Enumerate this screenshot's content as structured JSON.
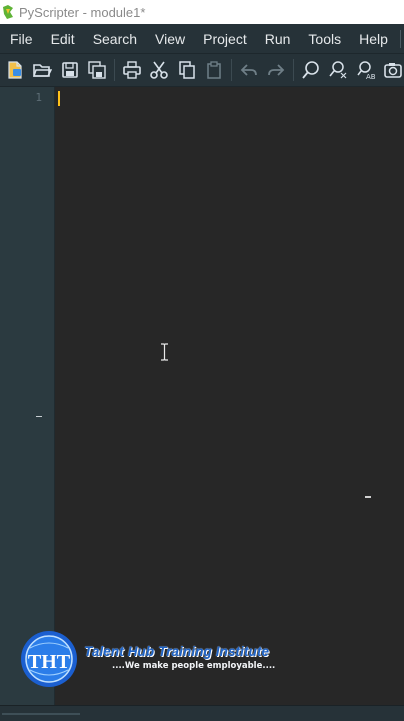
{
  "window": {
    "title": "PyScripter - module1*"
  },
  "menu": {
    "items": [
      "File",
      "Edit",
      "Search",
      "View",
      "Project",
      "Run",
      "Tools",
      "Help"
    ]
  },
  "toolbar": {
    "icons": [
      "new-file-icon",
      "open-folder-icon",
      "save-icon",
      "save-all-icon",
      "print-icon",
      "cut-icon",
      "copy-icon",
      "paste-icon",
      "undo-icon",
      "redo-icon",
      "find-icon",
      "find-in-files-icon",
      "replace-icon",
      "screenshot-icon"
    ]
  },
  "editor": {
    "line_numbers": [
      "1"
    ],
    "content": ""
  },
  "watermark": {
    "logo_text": "THT",
    "title": "Talent Hub Training Institute",
    "tagline": "....We make people employable...."
  },
  "colors": {
    "accent": "#ffc21a",
    "chrome": "#263238",
    "editor_bg": "#272727",
    "gutter_bg": "#2b3a40",
    "watermark_blue": "#1e63c6"
  }
}
